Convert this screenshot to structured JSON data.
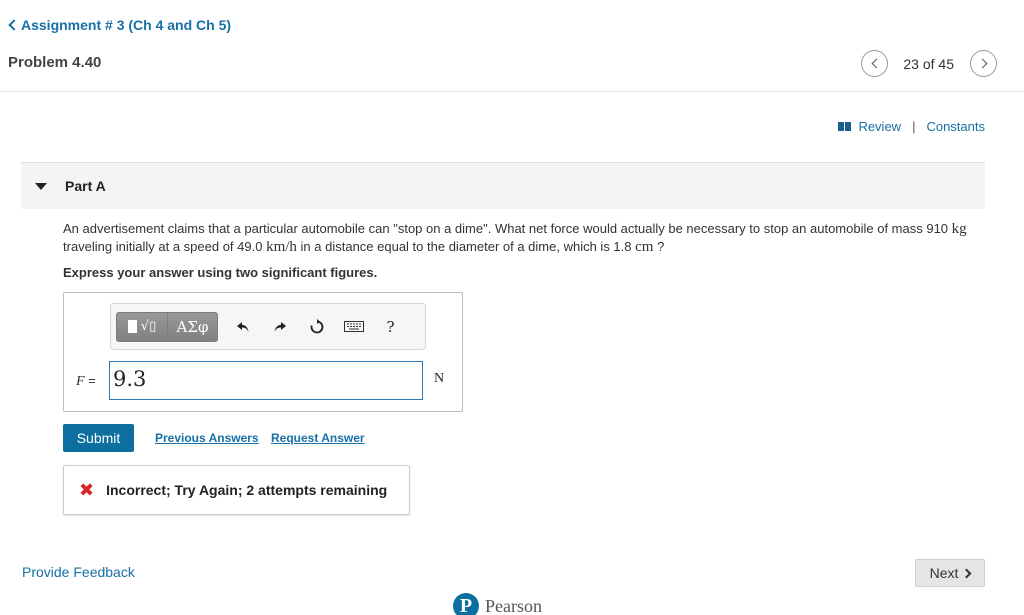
{
  "header": {
    "back_label": "Assignment # 3 (Ch 4 and Ch 5)",
    "problem_title": "Problem 4.40",
    "pager_text": "23 of 45"
  },
  "resources": {
    "review_label": "Review",
    "separator": "|",
    "constants_label": "Constants"
  },
  "part": {
    "label": "Part A"
  },
  "question": {
    "text_1": "An advertisement claims that a particular automobile can \"stop on a dime\". What net force would actually be necessary to stop an automobile of mass 910 ",
    "unit_kg": "kg",
    "text_2": " traveling initially at a speed of 49.0 ",
    "unit_kmh": "km/h",
    "text_3": " in a distance equal to the diameter of a dime, which is 1.8 ",
    "unit_cm": "cm",
    "text_4": " ?",
    "instruction": "Express your answer using two significant figures."
  },
  "answer": {
    "toolbar": {
      "template_icon": "sqrt-template-icon",
      "greek_label": "ΑΣφ",
      "help_label": "?"
    },
    "variable": "F",
    "equals": " =",
    "value": "9.3",
    "unit": "N"
  },
  "actions": {
    "submit_label": "Submit",
    "previous_answers_label": "Previous Answers",
    "request_answer_label": "Request Answer"
  },
  "feedback": {
    "message": "Incorrect; Try Again; 2 attempts remaining"
  },
  "footer": {
    "provide_feedback_label": "Provide Feedback",
    "next_label": "Next",
    "brand_name": "Pearson"
  },
  "colors": {
    "link": "#1770a6",
    "submit_bg": "#0d6f9f",
    "error": "#d8232a"
  }
}
